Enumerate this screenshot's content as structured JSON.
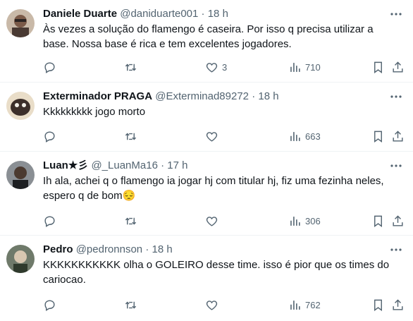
{
  "tweets": [
    {
      "name": "Daniele Duarte",
      "handle": "@daniduarte001",
      "sep": "·",
      "time": "18 h",
      "text": "Às vezes a solução do flamengo é caseira. Por isso q precisa utilizar a base. Nossa base é rica e tem excelentes jogadores.",
      "likes": "3",
      "views": "710"
    },
    {
      "name": "Exterminador PRAGA",
      "handle": "@Exterminad89272",
      "sep": "·",
      "time": "18 h",
      "text": "Kkkkkkkkk jogo morto",
      "likes": "",
      "views": "663"
    },
    {
      "name": "Luan★彡",
      "handle": "@_LuanMa16",
      "sep": "·",
      "time": "17 h",
      "text": "Ih ala, achei q o flamengo ia jogar hj com titular hj, fiz uma fezinha neles, espero q de bom😔",
      "likes": "",
      "views": "306"
    },
    {
      "name": "Pedro",
      "handle": "@pedronnson",
      "sep": "·",
      "time": "18 h",
      "text": "KKKKKKKKKKK olha o GOLEIRO desse time. isso é pior que os times do cariocao.",
      "likes": "",
      "views": "762"
    }
  ],
  "icons": {
    "reply": "reply-icon",
    "retweet": "retweet-icon",
    "like": "heart-icon",
    "views": "views-icon",
    "bookmark": "bookmark-icon",
    "share": "share-icon",
    "more": "more-icon"
  },
  "colors": {
    "text": "#0f1419",
    "secondary": "#536471",
    "divider": "#eff3f4"
  }
}
